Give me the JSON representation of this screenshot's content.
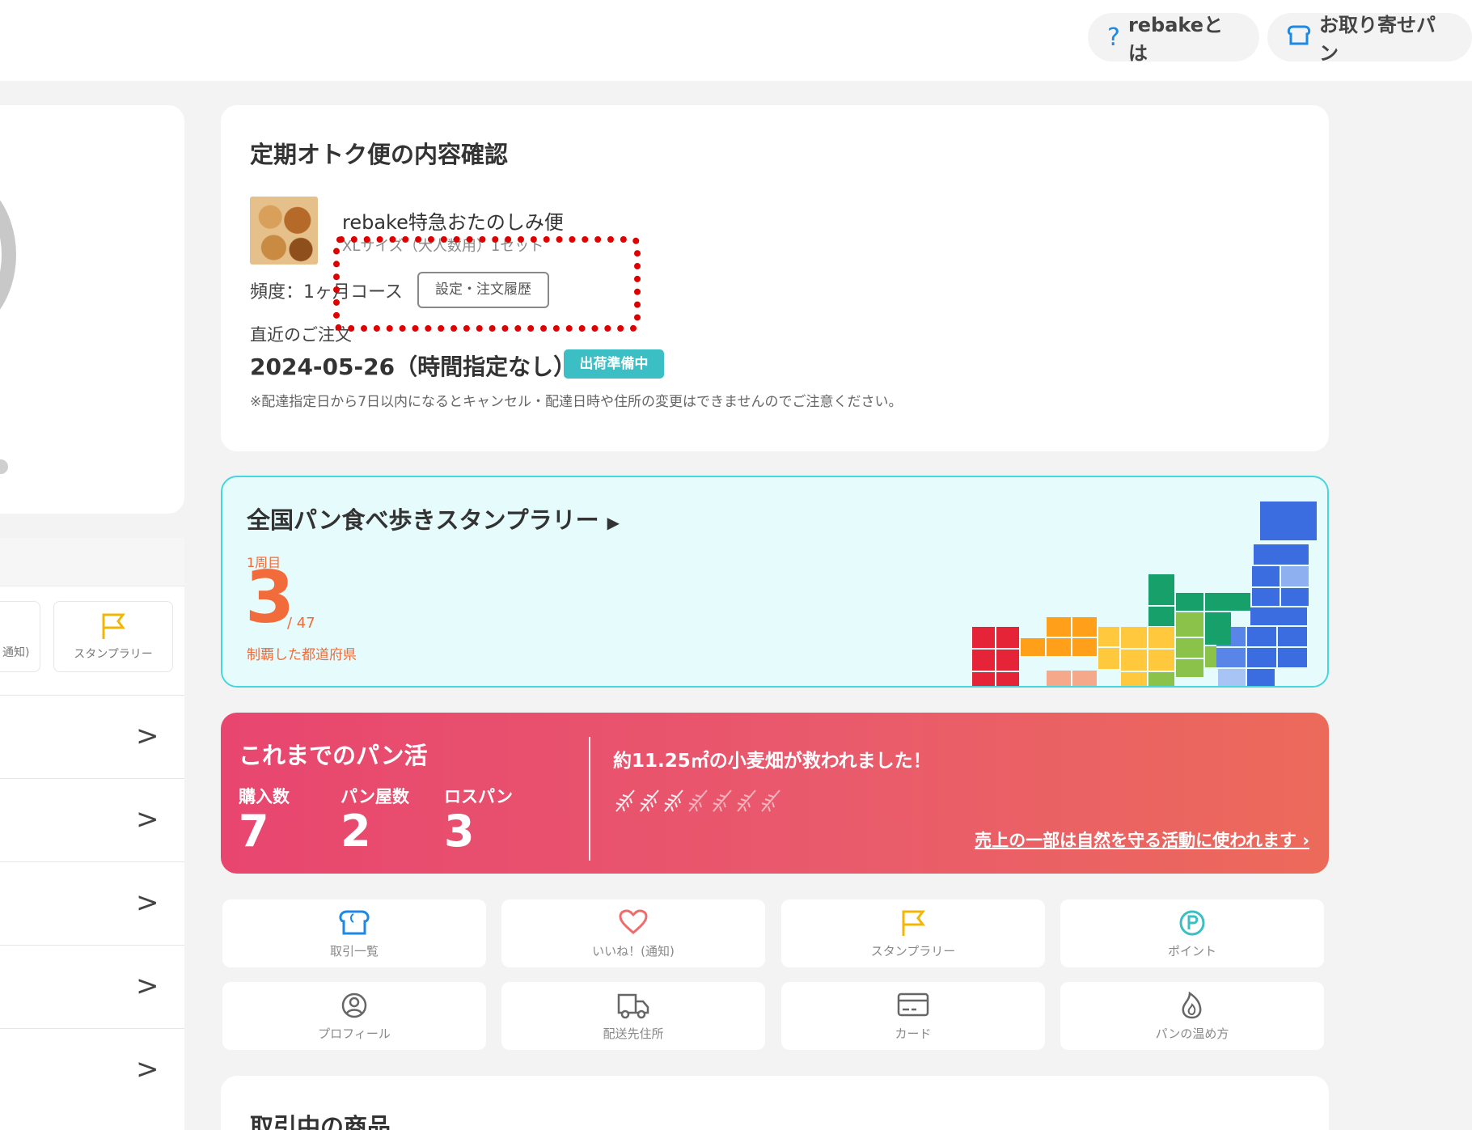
{
  "header": {
    "about_label": "rebakeとは",
    "order_bread_label": "お取り寄せパン"
  },
  "left_menu": {
    "tile_partial_label": "通知)",
    "tile_stamp_label": "スタンプラリー",
    "rows": [
      ">",
      ">",
      ">",
      ">",
      ">"
    ]
  },
  "subscription": {
    "title": "定期オトク便の内容確認",
    "product_name": "rebake特急おたのしみ便",
    "product_size": "XLサイズ（大人数用）1セット",
    "frequency": "頻度：1ヶ月コース",
    "settings_button": "設定・注文履歴",
    "recent_label": "直近のご注文",
    "recent_date": "2024-05-26（時間指定なし）",
    "status_badge": "出荷準備中",
    "note": "※配達指定日から7日以内になるとキャンセル・配達日時や住所の変更はできませんのでご注意ください。"
  },
  "rally": {
    "title": "全国パン食べ歩きスタンプラリー",
    "round_label": "1周目",
    "count": "3",
    "total": "/ 47",
    "conquered_label": "制覇した都道府県"
  },
  "activity": {
    "title": "これまでのパン活",
    "stats": [
      {
        "label": "購入数",
        "value": "7"
      },
      {
        "label": "パン屋数",
        "value": "2"
      },
      {
        "label": "ロスパン",
        "value": "3"
      }
    ],
    "wheat_text": "約11.25㎡の小麦畑が救われました！",
    "link": "売上の一部は自然を守る活動に使われます ›"
  },
  "quick_links": [
    {
      "label": "取引一覧",
      "icon": "bread-icon",
      "color": "#1e88e5"
    },
    {
      "label": "いいね！(通知)",
      "icon": "heart-icon",
      "color": "#f06b6b"
    },
    {
      "label": "スタンプラリー",
      "icon": "flag-icon",
      "color": "#f2b705"
    },
    {
      "label": "ポイント",
      "icon": "point-icon",
      "color": "#3cbfc4"
    },
    {
      "label": "プロフィール",
      "icon": "user-icon",
      "color": "#666666"
    },
    {
      "label": "配送先住所",
      "icon": "truck-icon",
      "color": "#666666"
    },
    {
      "label": "カード",
      "icon": "card-icon",
      "color": "#666666"
    },
    {
      "label": "パンの温め方",
      "icon": "flame-icon",
      "color": "#666666"
    }
  ],
  "trade": {
    "title": "取引中の商品"
  },
  "colors": {
    "accent": "#1e88e5",
    "orange": "#f26b3a",
    "teal": "#3cbfc4",
    "highlight": "#e00000"
  }
}
